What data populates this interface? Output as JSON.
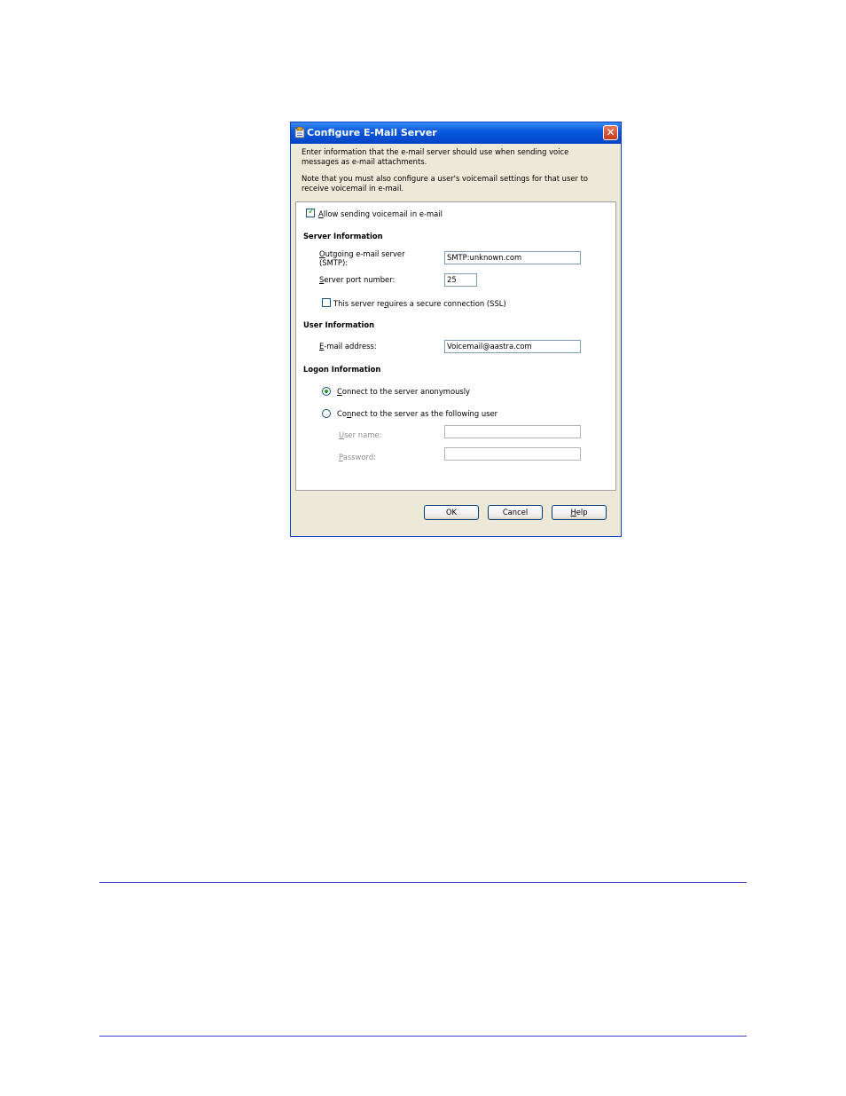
{
  "dialog": {
    "title": "Configure E-Mail Server",
    "intro_line1": "Enter information that the e-mail server should use when sending voice",
    "intro_line2": "messages as e-mail attachments.",
    "note_line1": "Note that you must also configure a user's voicemail settings for that user to",
    "note_line2": "receive voicemail in e-mail."
  },
  "allow_sending": {
    "label_u": "A",
    "label_rest": "llow sending voicemail in e-mail",
    "checked": true
  },
  "server_info": {
    "heading": "Server Information",
    "outgoing_label_u": "O",
    "outgoing_label_rest": "utgoing e-mail server",
    "outgoing_label_line2": "(SMTP):",
    "outgoing_value": "SMTP:unknown.com",
    "port_label_u": "S",
    "port_label_rest": "erver port number:",
    "port_value": "25",
    "ssl_label_pre": "This server re",
    "ssl_label_u": "q",
    "ssl_label_rest": "uires a secure connection (SSL)",
    "ssl_checked": false
  },
  "user_info": {
    "heading": "User Information",
    "email_label_u": "E",
    "email_label_rest": "-mail address:",
    "email_value": "Voicemail@aastra.com"
  },
  "logon_info": {
    "heading": "Logon Information",
    "anon_label_u": "C",
    "anon_label_rest": "onnect to the server anonymously",
    "anon_selected": true,
    "user_label_pre": "Co",
    "user_label_u": "n",
    "user_label_rest": "nect to the server as the following user",
    "username_label_u": "U",
    "username_label_rest": "ser name:",
    "username_value": "",
    "password_label_u": "P",
    "password_label_rest": "assword:",
    "password_value": ""
  },
  "buttons": {
    "ok": "OK",
    "cancel": "Cancel",
    "help_u": "H",
    "help_rest": "elp"
  },
  "colors": {
    "titlebar": "#0a5ae0",
    "check_green": "#21a121",
    "page_rule": "#3b3bc8"
  }
}
